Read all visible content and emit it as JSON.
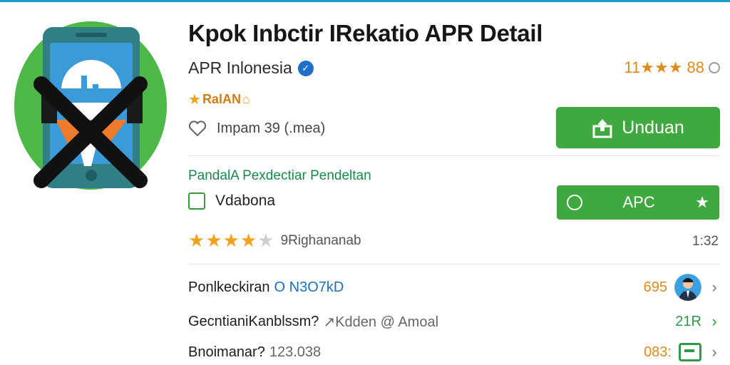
{
  "header": {
    "title": "Kpok Inbctir IRekatio APR Detail",
    "developer": "APR Inlonesia",
    "verified_glyph": "✓",
    "rating": "11★★★ 88",
    "badge": "RalAN"
  },
  "meta": {
    "size_text": "Impam 39  (.mea)"
  },
  "actions": {
    "download_label": "Unduan",
    "apk_label": "APC"
  },
  "details": {
    "section_title": "PandalA Pexdectiar Pendeltan",
    "option_label": "Vdabona",
    "review_label": "9Righananab",
    "rating_stars": 4,
    "rating_max": 5,
    "time": "1:32"
  },
  "list": [
    {
      "label": "Ponlkeckiran",
      "value": "O N3O7kD",
      "right_value": "695"
    },
    {
      "label": "GecntianiKanblssm?",
      "value": "↗Kdden @ Amoal",
      "right_value": "21R"
    },
    {
      "label": "Bnoimanar?",
      "value": "123.038",
      "right_value": "083:"
    }
  ],
  "colors": {
    "accent_green": "#3fa83f",
    "rating_orange": "#e08a1e",
    "link_green": "#188a4a",
    "top_bar_blue": "#1f9bd1",
    "list_value_blue": "#1a6fc4",
    "list_value_gray": "#666666"
  },
  "icons": {
    "app": "phone-x-icon",
    "verified": "verified-check-icon",
    "info": "info-circle-icon",
    "badge_star": "star-icon",
    "badge_home": "home-icon",
    "size": "heart-icon",
    "download": "upload-arrow-icon",
    "apk_left": "circle-icon",
    "apk_right": "star-icon",
    "row1": "avatar-icon",
    "row3": "calculator-icon",
    "chevron": "chevron-right-icon"
  }
}
